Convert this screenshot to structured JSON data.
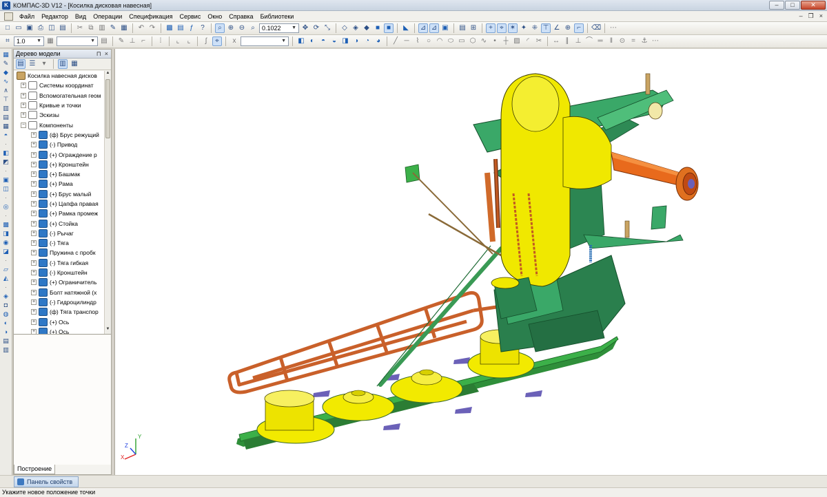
{
  "window": {
    "title": "КОМПАС-3D V12 - [Косилка дисковая навесная]",
    "app_icon": "kompas-logo-icon",
    "controls": {
      "minimize": "–",
      "maximize": "□",
      "close": "✕"
    }
  },
  "menu": {
    "items": [
      "Файл",
      "Редактор",
      "Вид",
      "Операции",
      "Спецификация",
      "Сервис",
      "Окно",
      "Справка",
      "Библиотеки"
    ],
    "doc_controls": {
      "minimize": "–",
      "restore": "❐",
      "close": "×"
    }
  },
  "toolbar1": {
    "zoom_value": "0.1022"
  },
  "toolbar2": {
    "step_value": "1.0",
    "coord_field": ""
  },
  "model_tree": {
    "title": "Дерево модели",
    "pin": "⊓",
    "close": "×",
    "tab_label": "Построение",
    "items": [
      {
        "label": "Косилка навесная дисков",
        "level": 0,
        "icon": "root-assembly-icon",
        "expander": ""
      },
      {
        "label": "Системы координат",
        "level": 1,
        "icon": "coordinate-system-icon",
        "expander": "+"
      },
      {
        "label": "Вспомогательная геом",
        "level": 1,
        "icon": "auxiliary-geometry-icon",
        "expander": "+"
      },
      {
        "label": "Кривые и точки",
        "level": 1,
        "icon": "curve-icon",
        "expander": "+"
      },
      {
        "label": "Эскизы",
        "level": 1,
        "icon": "sketch-icon",
        "expander": "+"
      },
      {
        "label": "Компоненты",
        "level": 1,
        "icon": "components-icon",
        "expander": "−"
      },
      {
        "label": "(ф) Брус режущий",
        "level": 2,
        "icon": "part-icon",
        "expander": "+"
      },
      {
        "label": "(-) Привод",
        "level": 2,
        "icon": "part-icon",
        "expander": "+"
      },
      {
        "label": "(+) Ограждение р",
        "level": 2,
        "icon": "part-icon",
        "expander": "+"
      },
      {
        "label": "(+) Кронштейн",
        "level": 2,
        "icon": "part-icon",
        "expander": "+"
      },
      {
        "label": "(+) Башмак",
        "level": 2,
        "icon": "part-icon",
        "expander": "+"
      },
      {
        "label": "(+) Рама",
        "level": 2,
        "icon": "part-icon",
        "expander": "+"
      },
      {
        "label": "(+) Брус малый",
        "level": 2,
        "icon": "part-icon",
        "expander": "+"
      },
      {
        "label": "(+) Цапфа правая",
        "level": 2,
        "icon": "part-icon",
        "expander": "+"
      },
      {
        "label": "(+) Рамка промеж",
        "level": 2,
        "icon": "part-icon",
        "expander": "+"
      },
      {
        "label": "(+) Стойка",
        "level": 2,
        "icon": "part-icon",
        "expander": "+"
      },
      {
        "label": "(-) Рычаг",
        "level": 2,
        "icon": "part-icon",
        "expander": "+"
      },
      {
        "label": "(-) Тяга",
        "level": 2,
        "icon": "part-icon",
        "expander": "+"
      },
      {
        "label": "Пружина с пробк",
        "level": 2,
        "icon": "part-icon",
        "expander": "+"
      },
      {
        "label": "(-) Тяга гибкая",
        "level": 2,
        "icon": "part-icon",
        "expander": "+"
      },
      {
        "label": "(-) Кронштейн",
        "level": 2,
        "icon": "part-icon",
        "expander": "+"
      },
      {
        "label": "(+) Ограничитель",
        "level": 2,
        "icon": "part-icon",
        "expander": "+"
      },
      {
        "label": "Болт натяжной (х",
        "level": 2,
        "icon": "part-icon",
        "expander": "+"
      },
      {
        "label": "(-) Гидроцилиндр",
        "level": 2,
        "icon": "part-icon",
        "expander": "+"
      },
      {
        "label": "(ф) Тяга транспор",
        "level": 2,
        "icon": "part-icon",
        "expander": "+"
      },
      {
        "label": "(+) Ось",
        "level": 2,
        "icon": "part-icon",
        "expander": "+"
      },
      {
        "label": "(+) Ось",
        "level": 2,
        "icon": "part-icon",
        "expander": "+"
      }
    ]
  },
  "viewport": {
    "model_name": "Косилка дисковая навесная",
    "axis_labels": {
      "x": "X",
      "y": "Y",
      "z": "Z"
    },
    "colors": {
      "frame_green": "#2e8b57",
      "frame_green_light": "#3fae6a",
      "drum_yellow": "#f0e800",
      "guard_orange": "#d0622a",
      "shaft_orange": "#e86a1c",
      "disc_bed_green": "#37a945"
    }
  },
  "properties_panel": {
    "tab_label": "Панель свойств"
  },
  "status": {
    "message": "Укажите новое положение точки"
  }
}
